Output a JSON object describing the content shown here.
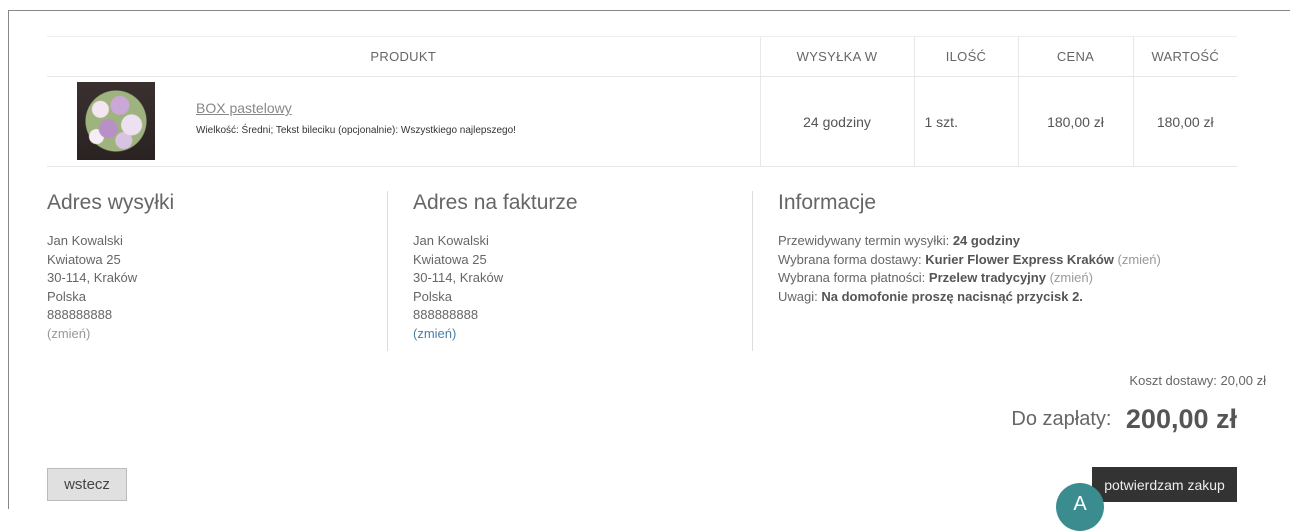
{
  "table": {
    "headers": [
      "PRODUKT",
      "WYSYŁKA W",
      "ILOŚĆ",
      "CENA",
      "WARTOŚĆ"
    ],
    "rows": [
      {
        "name": "BOX pastelowy",
        "options": "Wielkość: Średni; Tekst bileciku (opcjonalnie): Wszystkiego najlepszego!",
        "shipping": "24 godziny",
        "quantity": "1 szt.",
        "price": "180,00 zł",
        "value": "180,00 zł"
      }
    ]
  },
  "shipping_address": {
    "title": "Adres wysyłki",
    "lines": [
      "Jan Kowalski",
      "Kwiatowa 25",
      "30-114, Kraków",
      "Polska",
      "888888888"
    ],
    "change": "(zmień)"
  },
  "billing_address": {
    "title": "Adres na fakturze",
    "lines": [
      "Jan Kowalski",
      "Kwiatowa 25",
      "30-114, Kraków",
      "Polska",
      "888888888"
    ],
    "change": "(zmień)"
  },
  "info": {
    "title": "Informacje",
    "ship_time_label": "Przewidywany termin wysyłki:",
    "ship_time_value": "24 godziny",
    "delivery_label": "Wybrana forma dostawy:",
    "delivery_value": "Kurier Flower Express Kraków",
    "delivery_change": "(zmień)",
    "payment_label": "Wybrana forma płatności:",
    "payment_value": "Przelew tradycyjny",
    "payment_change": "(zmień)",
    "notes_label": "Uwagi:",
    "notes_value": "Na domofonie proszę nacisnąć przycisk 2."
  },
  "totals": {
    "shipping_cost": "Koszt dostawy: 20,00 zł",
    "to_pay_label": "Do zapłaty:",
    "to_pay_value": "200,00 zł"
  },
  "buttons": {
    "back": "wstecz",
    "confirm": "potwierdzam zakup"
  },
  "badge": "A"
}
